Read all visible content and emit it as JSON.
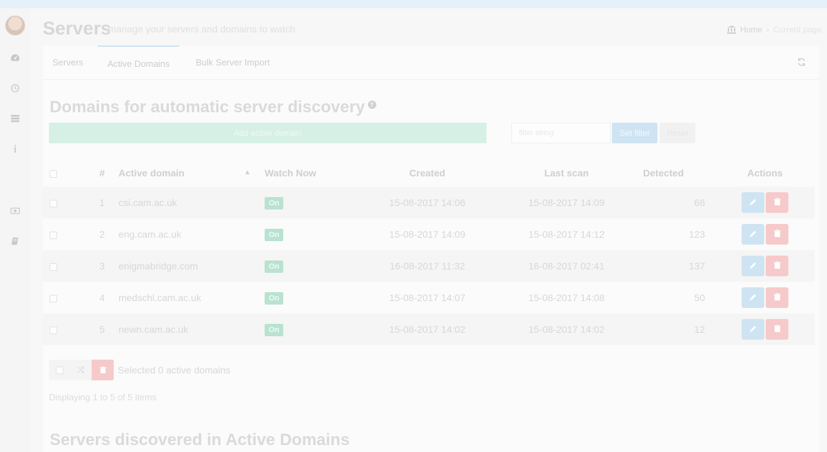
{
  "header": {
    "title": "Servers",
    "subtitle": "manage your servers and domains to watch",
    "breadcrumb": {
      "home": "Home",
      "current": "Current page"
    }
  },
  "tabs": [
    {
      "label": "Servers"
    },
    {
      "label": "Active Domains",
      "active": true
    },
    {
      "label": "Bulk Server Import"
    }
  ],
  "domains_section": {
    "title": "Domains for automatic server discovery",
    "add_button": "Add active domain",
    "filter_placeholder": "filter string",
    "set_filter": "Set filter",
    "reset": "Reset"
  },
  "table": {
    "columns": {
      "num": "#",
      "domain": "Active domain",
      "watch": "Watch Now",
      "created": "Created",
      "last_scan": "Last scan",
      "detected": "Detected",
      "actions": "Actions"
    },
    "rows": [
      {
        "num": "1",
        "domain": "csi.cam.ac.uk",
        "watch": "On",
        "created": "15-08-2017 14:06",
        "last_scan": "15-08-2017 14:09",
        "detected": "66"
      },
      {
        "num": "2",
        "domain": "eng.cam.ac.uk",
        "watch": "On",
        "created": "15-08-2017 14:09",
        "last_scan": "15-08-2017 14:12",
        "detected": "123"
      },
      {
        "num": "3",
        "domain": "enigmabridge.com",
        "watch": "On",
        "created": "16-08-2017 11:32",
        "last_scan": "16-08-2017 02:41",
        "detected": "137"
      },
      {
        "num": "4",
        "domain": "medschl.cam.ac.uk",
        "watch": "On",
        "created": "15-08-2017 14:07",
        "last_scan": "15-08-2017 14:08",
        "detected": "50"
      },
      {
        "num": "5",
        "domain": "newn.cam.ac.uk",
        "watch": "On",
        "created": "15-08-2017 14:02",
        "last_scan": "15-08-2017 14:02",
        "detected": "12"
      }
    ]
  },
  "bulk": {
    "selected_label": "Selected 0 active domains"
  },
  "paging": {
    "info": "Displaying 1 to 5 of 5 items"
  },
  "servers_section": {
    "title": "Servers discovered in Active Domains"
  },
  "sidebar_icons": [
    "avatar",
    "dashboard-icon",
    "history-icon",
    "servers-list-icon",
    "info-icon",
    "billing-icon",
    "docs-icon"
  ],
  "colors": {
    "accent": "#cfe4f3",
    "success": "#b9e2d1",
    "danger": "#f6caca",
    "add": "#d6f0e6"
  }
}
